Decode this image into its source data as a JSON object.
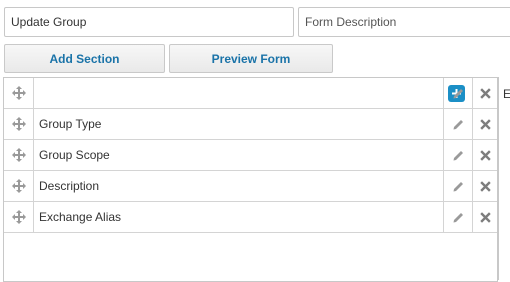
{
  "form": {
    "name_value": "Update Group",
    "description_placeholder": "Form Description"
  },
  "toolbar": {
    "add_section_label": "Add Section",
    "preview_form_label": "Preview Form"
  },
  "grid": {
    "rows": [
      {
        "label": "Group Type"
      },
      {
        "label": "Group Scope"
      },
      {
        "label": "Description"
      },
      {
        "label": "Exchange Alias"
      }
    ]
  },
  "edge_text": "E",
  "colors": {
    "accent": "#1b8fc6",
    "button_text": "#1a73a8",
    "icon_gray": "#9a9a9a"
  },
  "icons": [
    "move-icon",
    "plus-icon",
    "pencil-icon",
    "close-icon"
  ]
}
